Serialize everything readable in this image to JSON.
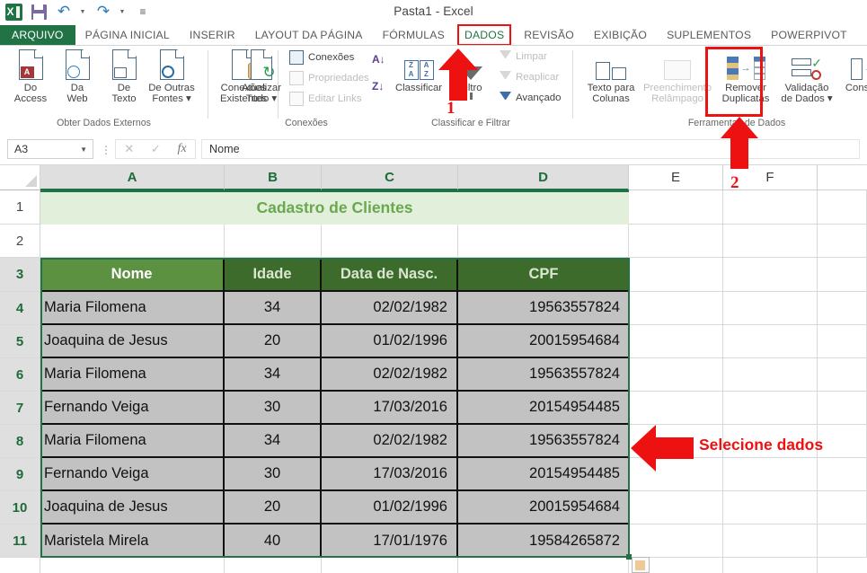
{
  "window": {
    "document_title": "Pasta1 - Excel",
    "quick_access": [
      {
        "name": "excel-logo",
        "label": "X"
      },
      {
        "name": "save-icon",
        "label": "Salvar"
      },
      {
        "name": "undo-icon",
        "label": "Desfazer"
      },
      {
        "name": "redo-icon",
        "label": "Refazer"
      },
      {
        "name": "customize-qat-icon",
        "label": "Personalizar Barra de Ferramentas"
      }
    ]
  },
  "ribbon": {
    "tabs": [
      {
        "label": "ARQUIVO",
        "state": "file"
      },
      {
        "label": "PÁGINA INICIAL",
        "state": "normal"
      },
      {
        "label": "INSERIR",
        "state": "normal"
      },
      {
        "label": "LAYOUT DA PÁGINA",
        "state": "normal"
      },
      {
        "label": "FÓRMULAS",
        "state": "normal"
      },
      {
        "label": "DADOS",
        "state": "active"
      },
      {
        "label": "REVISÃO",
        "state": "normal"
      },
      {
        "label": "EXIBIÇÃO",
        "state": "normal"
      },
      {
        "label": "SUPLEMENTOS",
        "state": "normal"
      },
      {
        "label": "POWERPIVOT",
        "state": "normal"
      }
    ],
    "groups": [
      {
        "label": "Obter Dados Externos"
      },
      {
        "label": "Conexões"
      },
      {
        "label": "Classificar e Filtrar"
      },
      {
        "label": "Ferramentas de Dados"
      }
    ],
    "external_data": [
      {
        "line1": "Do",
        "line2": "Access",
        "icon": "access-document-icon"
      },
      {
        "line1": "Da",
        "line2": "Web",
        "icon": "web-document-icon"
      },
      {
        "line1": "De",
        "line2": "Texto",
        "icon": "text-document-icon"
      },
      {
        "line1": "De Outras",
        "line2": "Fontes ▾",
        "icon": "other-sources-icon"
      },
      {
        "line1": "Conexões",
        "line2": "Existentes",
        "icon": "existing-connections-icon"
      }
    ],
    "connections": {
      "refresh_all_line1": "Atualizar",
      "refresh_all_line2": "Tudo ▾",
      "items": [
        {
          "label": "Conexões",
          "icon": "connections-icon",
          "dim": false
        },
        {
          "label": "Propriedades",
          "icon": "properties-icon",
          "dim": true
        },
        {
          "label": "Editar Links",
          "icon": "edit-links-icon",
          "dim": true
        }
      ]
    },
    "sort_filter": {
      "sort_az": "A↓",
      "sort_za": "Z↓",
      "sort_label": "Classificar",
      "filter_label": "Filtro",
      "items": [
        {
          "label": "Limpar",
          "icon": "clear-filter-icon",
          "dim": true
        },
        {
          "label": "Reaplicar",
          "icon": "reapply-filter-icon",
          "dim": true
        },
        {
          "label": "Avançado",
          "icon": "advanced-filter-icon",
          "dim": false
        }
      ]
    },
    "data_tools": [
      {
        "line1": "Texto para",
        "line2": "Colunas",
        "icon": "text-to-columns-icon",
        "dim": false,
        "highlighted": false
      },
      {
        "line1": "Preenchimento",
        "line2": "Relâmpago",
        "icon": "flash-fill-icon",
        "dim": true,
        "highlighted": false
      },
      {
        "line1": "Remover",
        "line2": "Duplicatas",
        "icon": "remove-duplicates-icon",
        "dim": false,
        "highlighted": true
      },
      {
        "line1": "Validação",
        "line2": "de Dados ▾",
        "icon": "data-validation-icon",
        "dim": false,
        "highlighted": false
      },
      {
        "line1": "Consolida",
        "line2": "",
        "icon": "consolidate-icon",
        "dim": false,
        "highlighted": false
      }
    ]
  },
  "formula_bar": {
    "name_box_value": "A3",
    "cancel_icon": "✕",
    "confirm_icon": "✓",
    "function_icon": "fx",
    "formula_value": "Nome"
  },
  "sheet": {
    "column_headers": [
      {
        "label": "A",
        "selected": true
      },
      {
        "label": "B",
        "selected": true
      },
      {
        "label": "C",
        "selected": true
      },
      {
        "label": "D",
        "selected": true
      },
      {
        "label": "E",
        "selected": false
      },
      {
        "label": "F",
        "selected": false
      }
    ],
    "row_headers": [
      {
        "label": "1",
        "selected": false
      },
      {
        "label": "2",
        "selected": false
      },
      {
        "label": "3",
        "selected": true
      },
      {
        "label": "4",
        "selected": true
      },
      {
        "label": "5",
        "selected": true
      },
      {
        "label": "6",
        "selected": true
      },
      {
        "label": "7",
        "selected": true
      },
      {
        "label": "8",
        "selected": true
      },
      {
        "label": "9",
        "selected": true
      },
      {
        "label": "10",
        "selected": true
      },
      {
        "label": "11",
        "selected": true
      }
    ],
    "sheet_title": "Cadastro de Clientes",
    "table_headers": [
      "Nome",
      "Idade",
      "Data de Nasc.",
      "CPF"
    ],
    "rows": [
      {
        "nome": "Maria Filomena",
        "idade": "34",
        "nasc": "02/02/1982",
        "cpf": "19563557824"
      },
      {
        "nome": "Joaquina de Jesus",
        "idade": "20",
        "nasc": "01/02/1996",
        "cpf": "20015954684"
      },
      {
        "nome": "Maria Filomena",
        "idade": "34",
        "nasc": "02/02/1982",
        "cpf": "19563557824"
      },
      {
        "nome": "Fernando Veiga",
        "idade": "30",
        "nasc": "17/03/2016",
        "cpf": "20154954485"
      },
      {
        "nome": "Maria Filomena",
        "idade": "34",
        "nasc": "02/02/1982",
        "cpf": "19563557824"
      },
      {
        "nome": "Fernando Veiga",
        "idade": "30",
        "nasc": "17/03/2016",
        "cpf": "20154954485"
      },
      {
        "nome": "Joaquina de Jesus",
        "idade": "20",
        "nasc": "01/02/1996",
        "cpf": "20015954684"
      },
      {
        "nome": "Maristela Mirela",
        "idade": "40",
        "nasc": "17/01/1976",
        "cpf": "19584265872"
      }
    ]
  },
  "annotations": {
    "step1": "1",
    "step2": "2",
    "select_data_text": "Selecione dados",
    "accent_color": "#ee1111",
    "brand_color": "#217346"
  }
}
